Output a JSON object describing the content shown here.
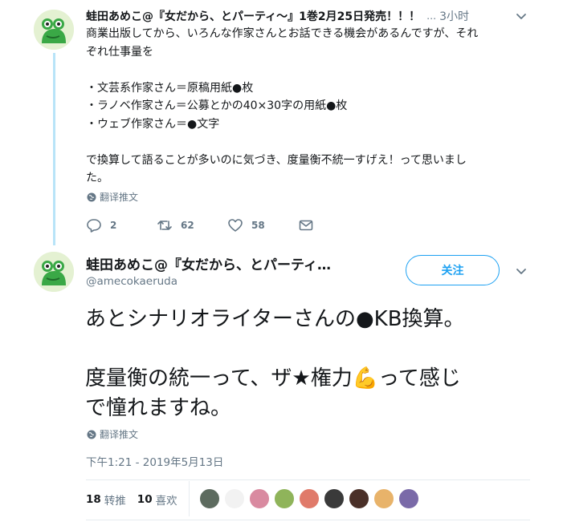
{
  "tweet1": {
    "author_name": "蛙田あめこ@『女だから、とパーティ〜』1巻2月25日発売！！！",
    "ellipsis": "…",
    "time": "3小时",
    "body_lines": [
      "商業出版してから、いろんな作家さんとお話できる機会があるんですが、それ",
      "ぞれ仕事量を",
      "",
      "・文芸系作家さん＝原稿用紙●枚",
      "・ラノベ作家さん＝公募とかの40×30字の用紙●枚",
      "・ウェブ作家さん＝●文字",
      "",
      "で換算して語ることが多いのに気づき、度量衡不統一すげえ！って思いまし",
      "た。"
    ],
    "translate_label": "翻译推文",
    "actions": {
      "reply_count": "2",
      "retweet_count": "62",
      "like_count": "58"
    }
  },
  "tweet2": {
    "author_name": "蛙田あめこ@『女だから、とパーティ…",
    "handle": "@amecokaeruda",
    "follow_label": "关注",
    "body_lines": [
      "あとシナリオライターさんの●KB換算。",
      "",
      "度量衡の統一って、ザ★権力💪って感じ",
      "で憧れますね。"
    ],
    "translate_label": "翻译推文",
    "date": "下午1:21 - 2019年5月13日",
    "stats": {
      "retweets_count": "18",
      "retweets_label": "转推",
      "likes_count": "10",
      "likes_label": "喜欢"
    },
    "liker_colors": [
      "#5d6b5f",
      "#f2f2f2",
      "#d98aa0",
      "#8fb45a",
      "#e07a6a",
      "#3a3a3a",
      "#4a3028",
      "#e8b36a",
      "#7a6aa8"
    ]
  },
  "colors": {
    "accent": "#1da1f2",
    "thread_line": "#b8e4f8",
    "secondary_text": "#657786"
  },
  "icons": {
    "avatar": "frog-avatar",
    "reply": "reply-icon",
    "retweet": "retweet-icon",
    "like": "heart-icon",
    "dm": "envelope-icon",
    "menu": "chevron-down-icon",
    "translate": "globe-icon"
  }
}
